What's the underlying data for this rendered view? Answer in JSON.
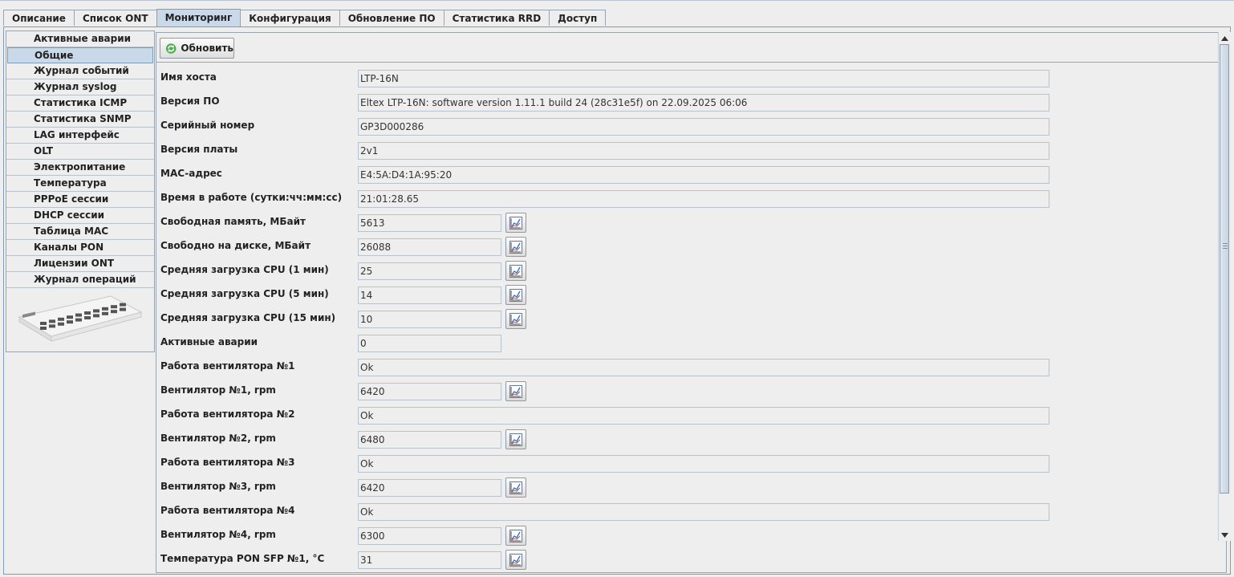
{
  "tabs": [
    "Описание",
    "Список ONT",
    "Мониторинг",
    "Конфигурация",
    "Обновление ПО",
    "Статистика RRD",
    "Доступ"
  ],
  "active_tab": 2,
  "sidebar": {
    "items": [
      "Активные аварии",
      "Общие",
      "Журнал событий",
      "Журнал syslog",
      "Статистика ICMP",
      "Статистика SNMP",
      "LAG интерфейс",
      "OLT",
      "Электропитание",
      "Температура",
      "PPPoE сессии",
      "DHCP сессии",
      "Таблица MAC",
      "Каналы PON",
      "Лицензии ONT",
      "Журнал операций"
    ],
    "active": 1
  },
  "toolbar": {
    "refresh_label": "Обновить"
  },
  "fields": [
    {
      "label": "Имя хоста",
      "value": "LTP-16N",
      "wide": true,
      "chart": false
    },
    {
      "label": "Версия ПО",
      "value": "Eltex LTP-16N: software version 1.11.1 build 24 (28c31e5f) on 22.09.2025 06:06",
      "wide": true,
      "chart": false
    },
    {
      "label": "Серийный номер",
      "value": "GP3D000286",
      "wide": true,
      "chart": false
    },
    {
      "label": "Версия платы",
      "value": "2v1",
      "wide": true,
      "chart": false
    },
    {
      "label": "MAC-адрес",
      "value": "E4:5A:D4:1A:95:20",
      "wide": true,
      "chart": false
    },
    {
      "label": "Время в работе (сутки:чч:мм:сс)",
      "value": "21:01:28.65",
      "wide": true,
      "chart": false
    },
    {
      "label": "Свободная память, МБайт",
      "value": "5613",
      "wide": false,
      "chart": true
    },
    {
      "label": "Свободно на диске, МБайт",
      "value": "26088",
      "wide": false,
      "chart": true
    },
    {
      "label": "Средняя загрузка CPU (1 мин)",
      "value": "25",
      "wide": false,
      "chart": true
    },
    {
      "label": "Средняя загрузка CPU (5 мин)",
      "value": "14",
      "wide": false,
      "chart": true
    },
    {
      "label": "Средняя загрузка CPU (15 мин)",
      "value": "10",
      "wide": false,
      "chart": true
    },
    {
      "label": "Активные аварии",
      "value": "0",
      "wide": false,
      "chart": false
    },
    {
      "label": "Работа вентилятора №1",
      "value": "Ok",
      "wide": true,
      "chart": false
    },
    {
      "label": "Вентилятор №1, rpm",
      "value": "6420",
      "wide": false,
      "chart": true
    },
    {
      "label": "Работа вентилятора №2",
      "value": "Ok",
      "wide": true,
      "chart": false
    },
    {
      "label": "Вентилятор №2, rpm",
      "value": "6480",
      "wide": false,
      "chart": true
    },
    {
      "label": "Работа вентилятора №3",
      "value": "Ok",
      "wide": true,
      "chart": false
    },
    {
      "label": "Вентилятор №3, rpm",
      "value": "6420",
      "wide": false,
      "chart": true
    },
    {
      "label": "Работа вентилятора №4",
      "value": "Ok",
      "wide": true,
      "chart": false
    },
    {
      "label": "Вентилятор №4, rpm",
      "value": "6300",
      "wide": false,
      "chart": true
    },
    {
      "label": "Температура PON SFP №1, °C",
      "value": "31",
      "wide": false,
      "chart": true
    }
  ],
  "colors": {
    "accent": "#c9d9ea",
    "border": "#7f9db9"
  },
  "icons": {
    "refresh": "refresh-icon",
    "chart": "chart-icon"
  }
}
